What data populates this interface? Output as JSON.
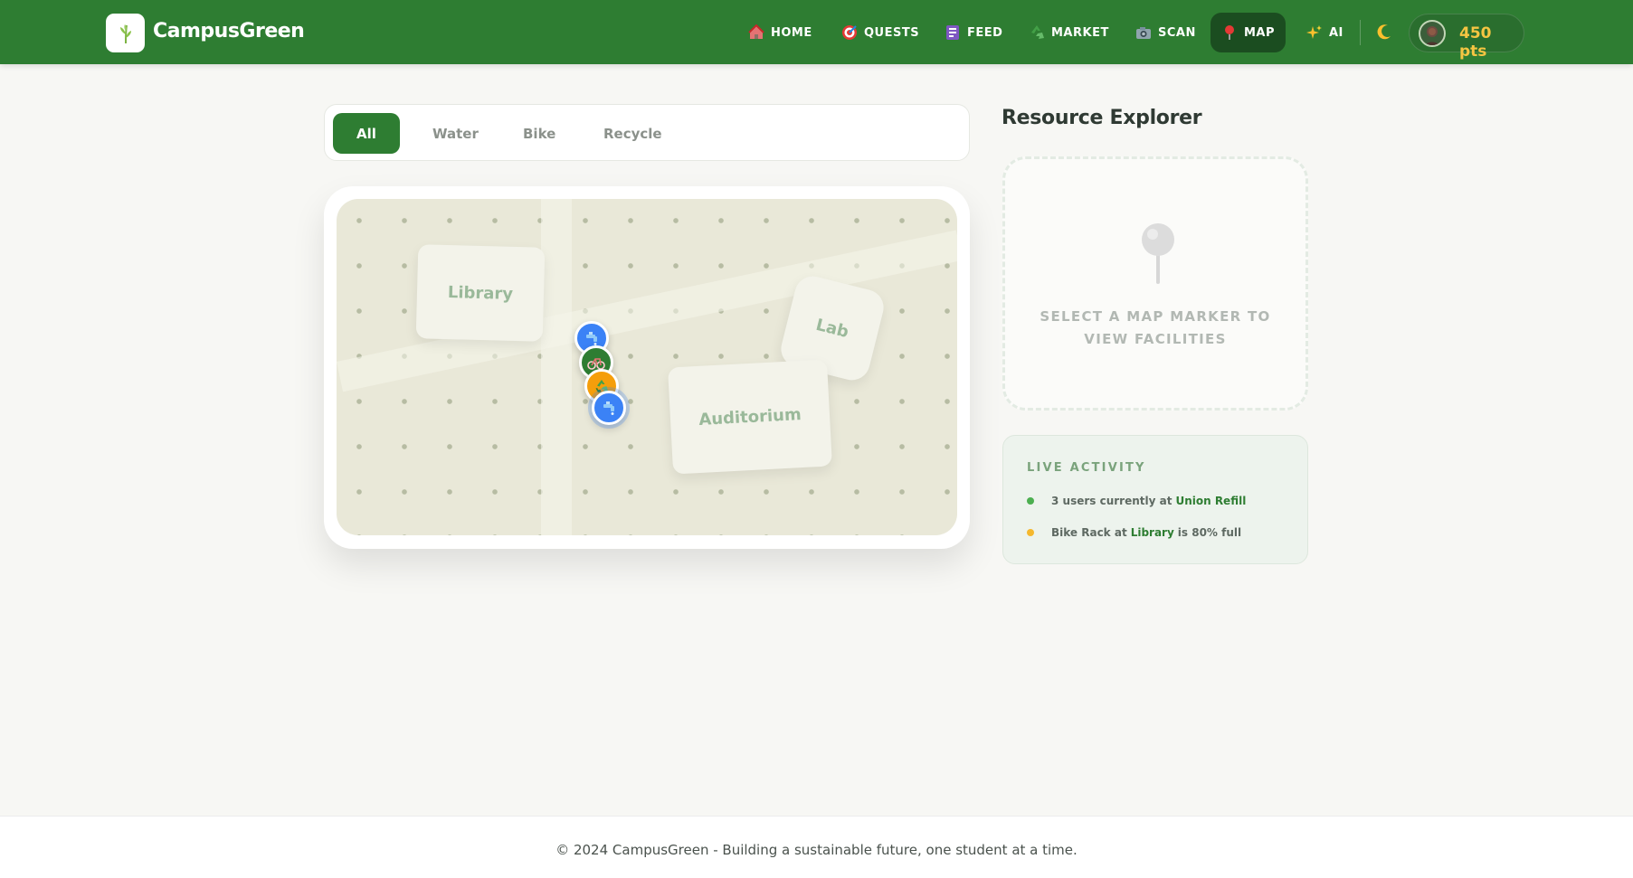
{
  "brand": {
    "name": "CampusGreen"
  },
  "nav": {
    "items": [
      {
        "label": "HOME",
        "icon": "house-icon"
      },
      {
        "label": "QUESTS",
        "icon": "target-icon"
      },
      {
        "label": "FEED",
        "icon": "newspaper-icon"
      },
      {
        "label": "MARKET",
        "icon": "recycle-icon"
      },
      {
        "label": "SCAN",
        "icon": "camera-icon"
      },
      {
        "label": "MAP",
        "icon": "pin-icon",
        "active": true
      },
      {
        "label": "AI",
        "icon": "sparkles-icon"
      }
    ],
    "theme_toggle_icon": "moon-icon",
    "points": "450 pts"
  },
  "filters": {
    "items": [
      "All",
      "Water",
      "Bike",
      "Recycle"
    ],
    "active": "All"
  },
  "map": {
    "buildings": [
      "Library",
      "Lab",
      "Auditorium"
    ],
    "markers": [
      {
        "type": "water",
        "icon": "water-tap-icon",
        "color": "#3b82f6"
      },
      {
        "type": "bike",
        "icon": "bike-icon",
        "color": "#2e7d32"
      },
      {
        "type": "recycle",
        "icon": "recycle-icon",
        "color": "#f59e0b"
      },
      {
        "type": "water",
        "icon": "water-tap-icon",
        "color": "#3b82f6"
      }
    ]
  },
  "resource_explorer": {
    "title": "Resource Explorer",
    "placeholder": "SELECT A MAP MARKER TO VIEW FACILITIES"
  },
  "live_activity": {
    "title": "LIVE ACTIVITY",
    "items": [
      {
        "prefix": "3 users currently at",
        "highlight": "Union Refill",
        "suffix": "",
        "dot_color": "#4caf50"
      },
      {
        "prefix": "Bike Rack at",
        "highlight": "Library",
        "suffix": "is 80% full",
        "dot_color": "#f5b82e"
      }
    ]
  },
  "footer": {
    "text": "© 2024 CampusGreen - Building a sustainable future, one student at a time."
  },
  "colors": {
    "primary": "#2e7d32",
    "primary_dark": "#1b4d20",
    "points": "#f5c542"
  }
}
